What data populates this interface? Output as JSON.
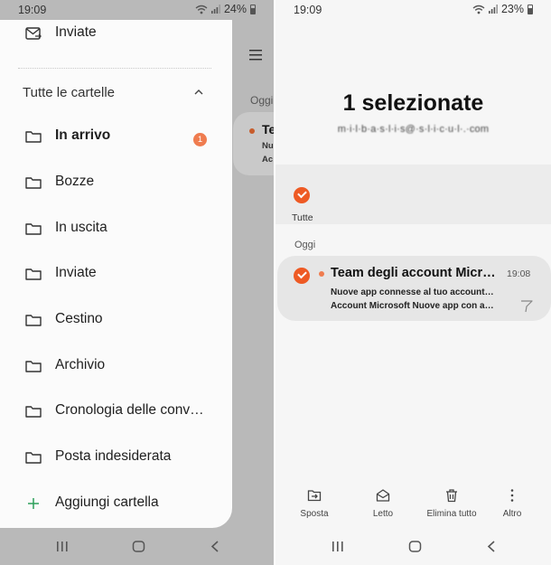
{
  "left_screen": {
    "status": {
      "time": "19:09",
      "battery": "24%"
    },
    "background_app": {
      "section_label": "Oggi",
      "card_title": "Te",
      "card_line1": "Nu",
      "card_line2": "Ac"
    },
    "drawer": {
      "top_item": "Inviate",
      "section_title": "Tutte le cartelle",
      "folders": [
        {
          "label": "In arrivo",
          "badge": "1"
        },
        {
          "label": "Bozze"
        },
        {
          "label": "In uscita"
        },
        {
          "label": "Inviate"
        },
        {
          "label": "Cestino"
        },
        {
          "label": "Archivio"
        },
        {
          "label": "Cronologia delle conve…"
        },
        {
          "label": "Posta indesiderata"
        }
      ],
      "add_folder": "Aggiungi cartella"
    }
  },
  "right_screen": {
    "status": {
      "time": "19:09",
      "battery": "23%"
    },
    "selection_title": "1 selezionate",
    "account_email": "m·i·l·b·a·s·l·i·s@·s·l·i·c·u·l·.·com",
    "select_all_label": "Tutte",
    "section_label": "Oggi",
    "mail": {
      "sender": "Team degli account Micro…",
      "time": "19:08",
      "subject": "Nuove app connesse al tuo account…",
      "preview": "Account Microsoft Nuove app con a…"
    },
    "actions": [
      {
        "label": "Sposta",
        "icon": "move-icon"
      },
      {
        "label": "Letto",
        "icon": "mark-read-icon"
      },
      {
        "label": "Elimina tutto",
        "icon": "trash-icon"
      },
      {
        "label": "Altro",
        "icon": "more-vertical-icon"
      }
    ]
  },
  "colors": {
    "accent": "#ee5a24",
    "badge": "#ef7c4f",
    "add_green": "#2ca05a"
  }
}
